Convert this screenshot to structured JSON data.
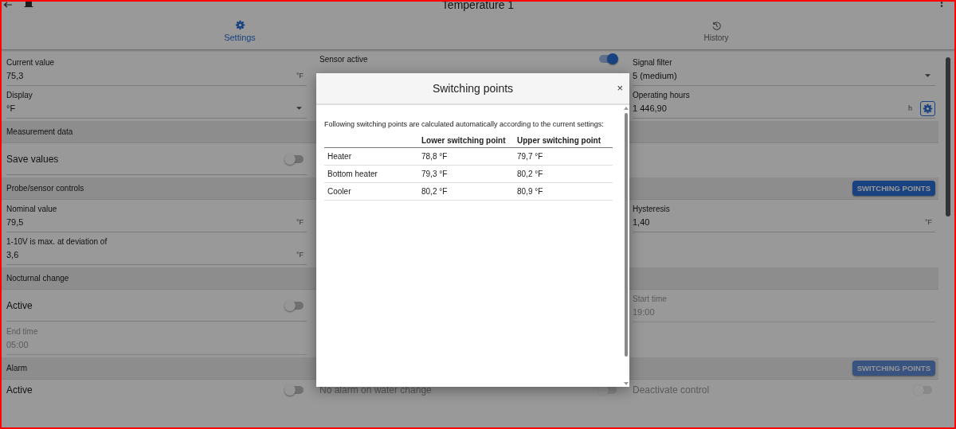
{
  "header": {
    "title": "Temperature 1"
  },
  "tabs": [
    {
      "label": "Settings",
      "selected": true
    },
    {
      "label": "History",
      "selected": false
    }
  ],
  "content": [
    {
      "kind": "row",
      "cells": [
        {
          "kind": "input",
          "label": "Current value",
          "value": "75,3",
          "unit": "°F",
          "disabled": false
        },
        {
          "kind": "toggle",
          "label": "Sensor active",
          "on": true,
          "disabled": false
        },
        {
          "kind": "select",
          "label": "Signal filter",
          "value": "5 (medium)",
          "disabled": false
        }
      ]
    },
    {
      "kind": "row",
      "cells": [
        {
          "kind": "select",
          "label": "Display",
          "value": "°F",
          "disabled": false
        },
        {
          "kind": "empty"
        },
        {
          "kind": "input",
          "label": "Operating hours",
          "value": "1 446,90",
          "unit": "h",
          "settings_button": true,
          "disabled": false
        }
      ]
    },
    {
      "kind": "section",
      "title": "Measurement data"
    },
    {
      "kind": "row",
      "cells": [
        {
          "kind": "toggle",
          "label": "Save values",
          "on": false,
          "disabled": false
        },
        {
          "kind": "empty"
        },
        {
          "kind": "empty"
        }
      ]
    },
    {
      "kind": "section",
      "title": "Probe/sensor controls",
      "button": {
        "label": "SWITCHING POINTS",
        "disabled": false
      }
    },
    {
      "kind": "row",
      "cells": [
        {
          "kind": "input",
          "label": "Nominal value",
          "value": "79,5",
          "unit": "°F",
          "disabled": false
        },
        {
          "kind": "empty"
        },
        {
          "kind": "input",
          "label": "Hysteresis",
          "value": "1,40",
          "unit": "°F",
          "disabled": false
        }
      ]
    },
    {
      "kind": "row",
      "cells": [
        {
          "kind": "input",
          "label": "1-10V is max. at deviation of",
          "value": "3,6",
          "unit": "°F",
          "disabled": false
        },
        {
          "kind": "empty"
        },
        {
          "kind": "empty"
        }
      ]
    },
    {
      "kind": "section",
      "title": "Nocturnal change"
    },
    {
      "kind": "row",
      "cells": [
        {
          "kind": "toggle",
          "label": "Active",
          "on": false,
          "disabled": false
        },
        {
          "kind": "empty"
        },
        {
          "kind": "input",
          "label": "Start time",
          "value": "19:00",
          "disabled": true
        }
      ]
    },
    {
      "kind": "row",
      "cells": [
        {
          "kind": "input",
          "label": "End time",
          "value": "05:00",
          "disabled": true
        },
        {
          "kind": "empty"
        },
        {
          "kind": "empty"
        }
      ]
    },
    {
      "kind": "section",
      "title": "Alarm",
      "button": {
        "label": "SWITCHING POINTS",
        "disabled": true
      }
    },
    {
      "kind": "row",
      "cells": [
        {
          "kind": "toggle",
          "label": "Active",
          "on": false,
          "disabled": false
        },
        {
          "kind": "toggle",
          "label": "No alarm on water change",
          "on": false,
          "disabled": true
        },
        {
          "kind": "toggle",
          "label": "Deactivate control",
          "on": false,
          "disabled": true
        }
      ]
    }
  ],
  "dialog": {
    "title": "Switching points",
    "close": "×",
    "intro": "Following switching points are calculated automatically according to the current settings:",
    "columns": [
      "Lower switching point",
      "Upper switching point"
    ],
    "rows": [
      {
        "name": "Heater",
        "lower": "78,8 °F",
        "upper": "79,7 °F"
      },
      {
        "name": "Bottom heater",
        "lower": "79,3 °F",
        "upper": "80,2 °F"
      },
      {
        "name": "Cooler",
        "lower": "80,2 °F",
        "upper": "80,9 °F"
      }
    ]
  }
}
